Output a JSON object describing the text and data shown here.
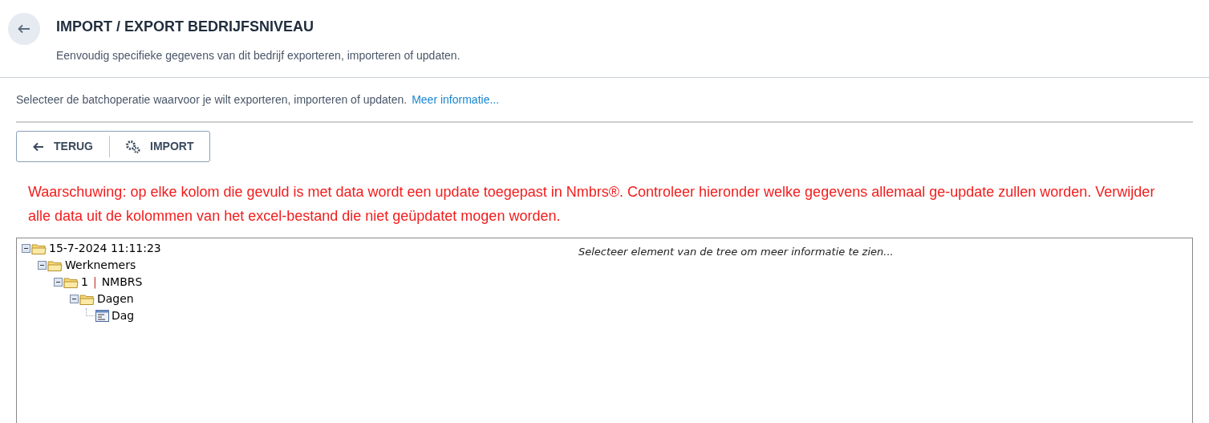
{
  "header": {
    "title": "IMPORT / EXPORT BEDRIJFSNIVEAU",
    "subtitle": "Eenvoudig specifieke gegevens van dit bedrijf exporteren, importeren of updaten."
  },
  "intro": {
    "text": "Selecteer de batchoperatie waarvoor je wilt exporteren, importeren of updaten.",
    "link": "Meer informatie..."
  },
  "toolbar": [
    {
      "label": "TERUG",
      "kind": "back"
    },
    {
      "label": "IMPORT",
      "kind": "gears"
    }
  ],
  "warning": "Waarschuwing: op elke kolom die gevuld is met data wordt een update toegepast in Nmbrs®. Controleer hieronder welke gegevens allemaal ge-update zullen worden. Verwijder alle data uit de kolommen van het excel-bestand die niet geüpdatet mogen worden.",
  "tree": [
    {
      "label": "15-7-2024 11:11:23",
      "kind": "folder",
      "expanded": true,
      "children": [
        {
          "label": "Werknemers",
          "kind": "folder",
          "expanded": true,
          "children": [
            {
              "label": "1",
              "separator": "|",
              "extra": "NMBRS",
              "kind": "folder",
              "expanded": true,
              "children": [
                {
                  "label": "Dagen",
                  "kind": "folder",
                  "expanded": true,
                  "children": [
                    {
                      "label": "Dag",
                      "kind": "item"
                    }
                  ]
                }
              ]
            }
          ]
        }
      ]
    }
  ],
  "detail_hint": "Selecteer element van de tree om meer informatie te zien..."
}
